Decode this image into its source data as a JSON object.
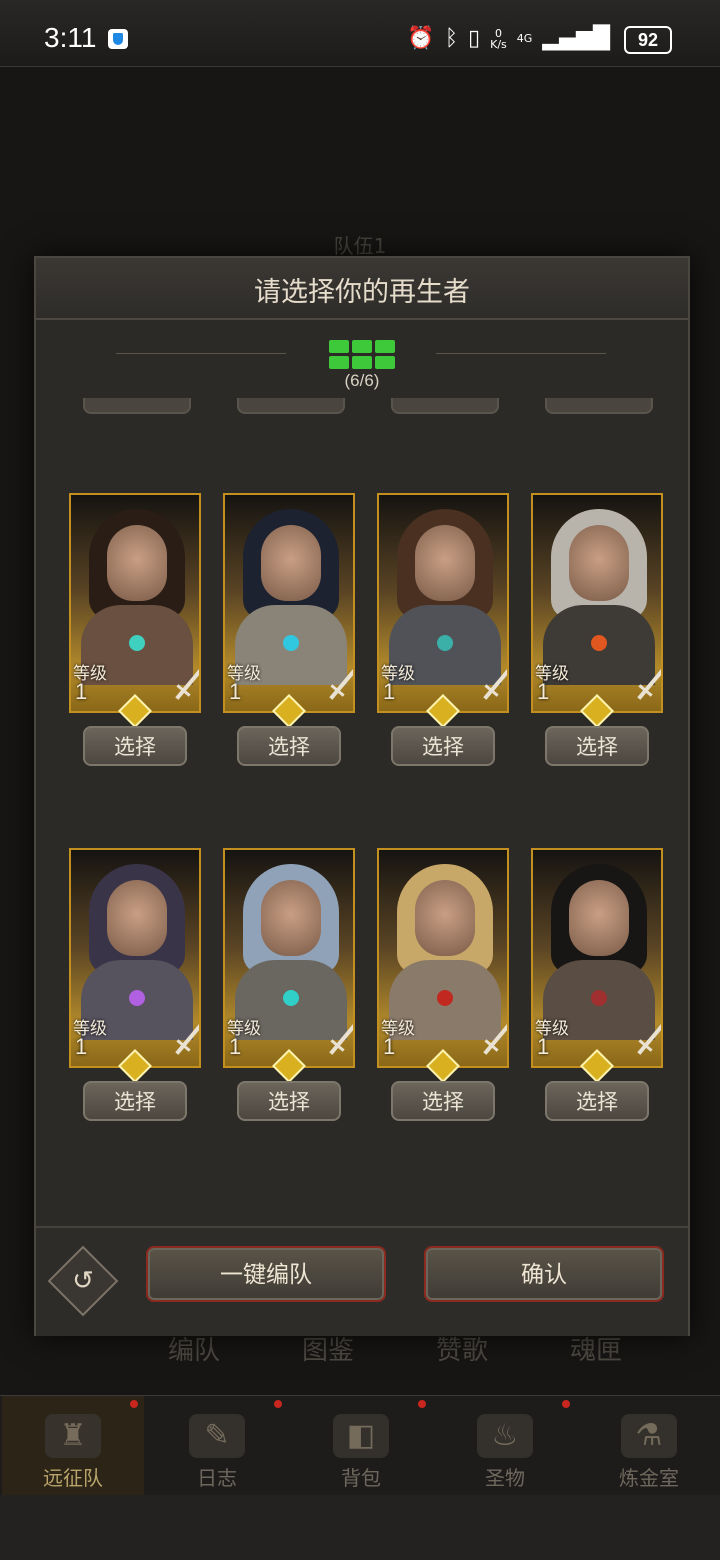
{
  "status_bar": {
    "time": "3:11",
    "net_speed": "0\nK/s",
    "network": "4G",
    "battery": "92"
  },
  "background": {
    "team_title": "队伍1",
    "tabs": [
      "编队",
      "图鉴",
      "赞歌",
      "魂匣"
    ],
    "nav": [
      {
        "label": "远征队",
        "icon": "helmet-icon",
        "active": true,
        "badge": true
      },
      {
        "label": "日志",
        "icon": "journal-icon",
        "active": false,
        "badge": true
      },
      {
        "label": "背包",
        "icon": "backpack-icon",
        "active": false,
        "badge": true
      },
      {
        "label": "圣物",
        "icon": "relic-icon",
        "active": false,
        "badge": true
      },
      {
        "label": "炼金室",
        "icon": "alchemy-icon",
        "active": false,
        "badge": true
      }
    ]
  },
  "modal": {
    "title": "请选择你的再生者",
    "counter": "(6/6)",
    "level_label": "等级",
    "select_label": "选择",
    "characters": [
      {
        "level": "1"
      },
      {
        "level": "1"
      },
      {
        "level": "1"
      },
      {
        "level": "1"
      },
      {
        "level": "1"
      },
      {
        "level": "1"
      },
      {
        "level": "1"
      },
      {
        "level": "1"
      }
    ],
    "auto_team_label": "一键编队",
    "confirm_label": "确认"
  },
  "colors": {
    "accent_gold": "#c39020",
    "slot_green": "#3ec93a",
    "badge_red": "#c8261f"
  }
}
